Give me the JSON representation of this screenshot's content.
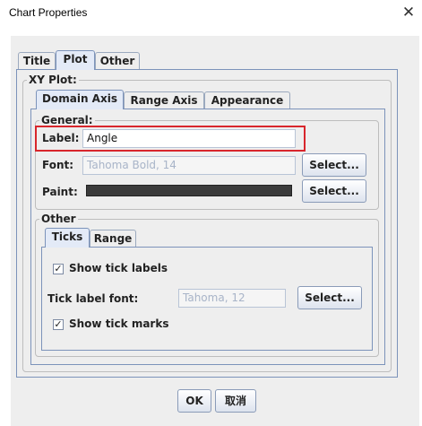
{
  "window": {
    "title": "Chart Properties",
    "close_glyph": "✕"
  },
  "outer_tabs": [
    {
      "label": "Title",
      "selected": false
    },
    {
      "label": "Plot",
      "selected": true
    },
    {
      "label": "Other",
      "selected": false
    }
  ],
  "xy_plot": {
    "legend": "XY Plot:",
    "tabs": [
      {
        "label": "Domain Axis",
        "selected": true
      },
      {
        "label": "Range Axis",
        "selected": false
      },
      {
        "label": "Appearance",
        "selected": false
      }
    ],
    "general": {
      "legend": "General:",
      "label_caption": "Label:",
      "label_value": "Angle",
      "font_caption": "Font:",
      "font_value": "Tahoma Bold, 14",
      "font_select": "Select...",
      "paint_caption": "Paint:",
      "paint_color": "#3b3b3b",
      "paint_select": "Select..."
    },
    "other": {
      "legend": "Other",
      "tabs": [
        {
          "label": "Ticks",
          "selected": true
        },
        {
          "label": "Range",
          "selected": false
        }
      ],
      "show_tick_labels": {
        "label": "Show tick labels",
        "checked": true
      },
      "tick_font_caption": "Tick label font:",
      "tick_font_value": "Tahoma, 12",
      "tick_font_select": "Select...",
      "show_tick_marks": {
        "label": "Show tick marks",
        "checked": true
      }
    }
  },
  "footer": {
    "ok": "OK",
    "cancel": "取消"
  },
  "colors": {
    "highlight": "#d8262c",
    "tab_selected": "#e3eaf7"
  }
}
